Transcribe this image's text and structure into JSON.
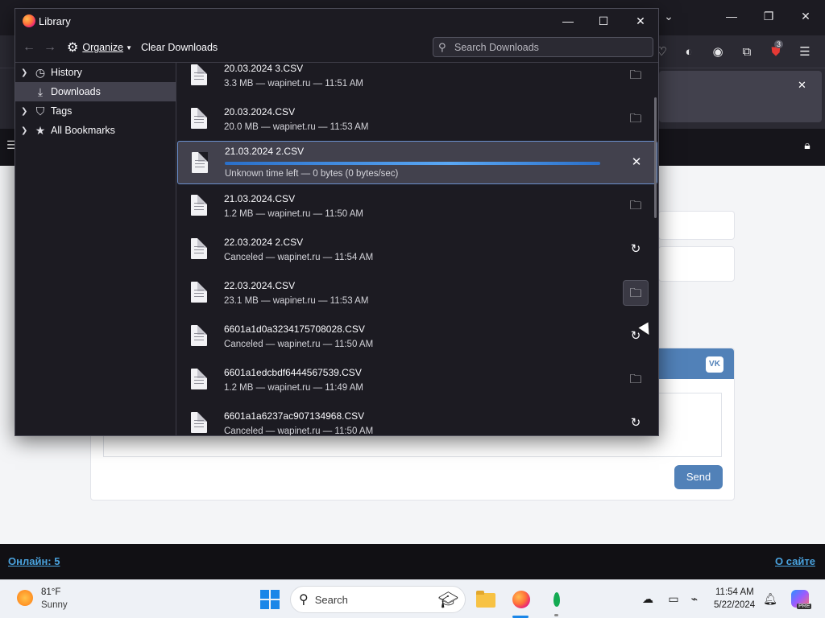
{
  "library": {
    "title": "Library",
    "toolbar": {
      "organize_label": "Organize",
      "clear_label": "Clear Downloads",
      "search_placeholder": "Search Downloads"
    },
    "sidebar": {
      "items": [
        {
          "label": "History",
          "icon": "clock-icon"
        },
        {
          "label": "Downloads",
          "icon": "download-icon",
          "selected": true
        },
        {
          "label": "Tags",
          "icon": "tag-icon"
        },
        {
          "label": "All Bookmarks",
          "icon": "star-icon"
        }
      ]
    },
    "downloads": [
      {
        "name": "20.03.2024 3.CSV",
        "status": "3.3 MB — wapinet.ru — 11:51 AM",
        "action": "folder-icon"
      },
      {
        "name": "20.03.2024.CSV",
        "status": "20.0 MB — wapinet.ru — 11:53 AM",
        "action": "folder-icon"
      },
      {
        "name": "21.03.2024 2.CSV",
        "status": "Unknown time left — 0 bytes (0 bytes/sec)",
        "action": "cancel-icon",
        "progress": 0.0
      },
      {
        "name": "21.03.2024.CSV",
        "status": "1.2 MB — wapinet.ru — 11:50 AM",
        "action": "folder-icon"
      },
      {
        "name": "22.03.2024 2.CSV",
        "status": "Canceled — wapinet.ru — 11:54 AM",
        "action": "retry-icon"
      },
      {
        "name": "22.03.2024.CSV",
        "status": "23.1 MB — wapinet.ru — 11:53 AM",
        "action": "folder-icon"
      },
      {
        "name": "6601a1d0a3234175708028.CSV",
        "status": "Canceled — wapinet.ru — 11:50 AM",
        "action": "retry-icon"
      },
      {
        "name": "6601a1edcbdf6444567539.CSV",
        "status": "1.2 MB — wapinet.ru — 11:49 AM",
        "action": "folder-icon"
      },
      {
        "name": "6601a1a6237ac907134968.CSV",
        "status": "Canceled — wapinet.ru — 11:50 AM",
        "action": "retry-icon"
      }
    ]
  },
  "background_page": {
    "send_label": "Send",
    "online_label": "Онлайн: 5",
    "about_label": "О сайте",
    "extension_badge": "3",
    "vk_label": "VK"
  },
  "taskbar": {
    "weather_temp": "81°F",
    "weather_condition": "Sunny",
    "search_label": "Search",
    "clock_time": "11:54 AM",
    "clock_date": "5/22/2024",
    "copilot_badge": "PRE"
  },
  "colors": {
    "window_bg": "#1c1b22",
    "selected_row": "#42414d",
    "accent_blue": "#5181b8",
    "progress_blue": "#3a8ee6"
  }
}
